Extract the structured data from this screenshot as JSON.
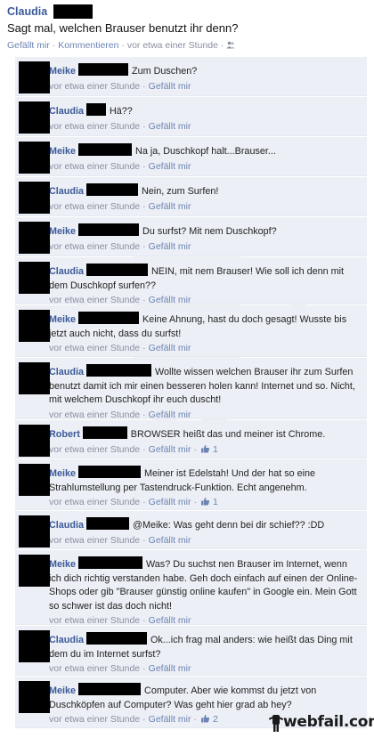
{
  "post": {
    "author": "Claudia",
    "text": "Sagt mal, welchen Brauser benutzt ihr denn?",
    "like_label": "Gefällt mir",
    "comment_label": "Kommentieren",
    "time": "vor etwa einer Stunde",
    "separator": "·",
    "privacy_icon": "friends-icon"
  },
  "comments": [
    {
      "author": "Meike",
      "text": "Zum Duschen?",
      "time": "vor etwa einer Stunde",
      "like_label": "Gefällt mir",
      "likes": ""
    },
    {
      "author": "Claudia",
      "text": "Hä??",
      "time": "vor etwa einer Stunde",
      "like_label": "Gefällt mir",
      "likes": ""
    },
    {
      "author": "Meike",
      "text": "Na ja, Duschkopf halt...Brauser...",
      "time": "vor etwa einer Stunde",
      "like_label": "Gefällt mir",
      "likes": ""
    },
    {
      "author": "Claudia",
      "text": "Nein, zum Surfen!",
      "time": "vor etwa einer Stunde",
      "like_label": "Gefällt mir",
      "likes": ""
    },
    {
      "author": "Meike",
      "text": "Du surfst? Mit nem Duschkopf?",
      "time": "vor etwa einer Stunde",
      "like_label": "Gefällt mir",
      "likes": ""
    },
    {
      "author": "Claudia",
      "text": "NEIN, mit nem Brauser! Wie soll ich denn mit dem Duschkopf surfen??",
      "time": "vor etwa einer Stunde",
      "like_label": "Gefällt mir",
      "likes": ""
    },
    {
      "author": "Meike",
      "text": "Keine Ahnung, hast du doch gesagt! Wusste bis jetzt auch nicht, dass du surfst!",
      "time": "vor etwa einer Stunde",
      "like_label": "Gefällt mir",
      "likes": ""
    },
    {
      "author": "Claudia",
      "text": "Wollte wissen welchen Brauser ihr zum Surfen benutzt damit ich mir einen besseren holen kann! Internet und so. Nicht, mit welchem Duschkopf ihr euch duscht!",
      "time": "vor etwa einer Stunde",
      "like_label": "Gefällt mir",
      "likes": ""
    },
    {
      "author": "Robert",
      "text": "BROWSER heißt das und meiner ist Chrome.",
      "time": "vor etwa einer Stunde",
      "like_label": "Gefällt mir",
      "likes": "1"
    },
    {
      "author": "Meike",
      "text": "Meiner ist Edelstah! Und der hat so eine Strahlumstellung per Tastendruck-Funktion. Echt angenehm.",
      "time": "vor etwa einer Stunde",
      "like_label": "Gefällt mir",
      "likes": "1"
    },
    {
      "author": "Claudia",
      "text": "@Meike: Was geht denn bei dir schief?? :DD",
      "time": "vor etwa einer Stunde",
      "like_label": "Gefällt mir",
      "likes": ""
    },
    {
      "author": "Meike",
      "text": "Was? Du suchst nen Brauser im Internet, wenn ich dich richtig verstanden habe. Geh doch einfach auf einen der Online-Shops oder gib \"Brauser günstig online kaufen\" in Google ein. Mein Gott so schwer ist das doch nicht!",
      "time": "vor etwa einer Stunde",
      "like_label": "Gefällt mir",
      "likes": ""
    },
    {
      "author": "Claudia",
      "text": "Ok...ich frag mal anders: wie heißt das Ding mit dem du im Internet surfst?",
      "time": "vor etwa einer Stunde",
      "like_label": "Gefällt mir",
      "likes": ""
    },
    {
      "author": "Meike",
      "text": "Computer. Aber wie kommst du jetzt von Duschköpfen auf Computer? Was geht hier grad ab hey?",
      "time": "vor etwa einer Stunde",
      "like_label": "Gefällt mir",
      "likes": "2"
    }
  ],
  "watermark": {
    "logo_text": "webfail.com"
  }
}
